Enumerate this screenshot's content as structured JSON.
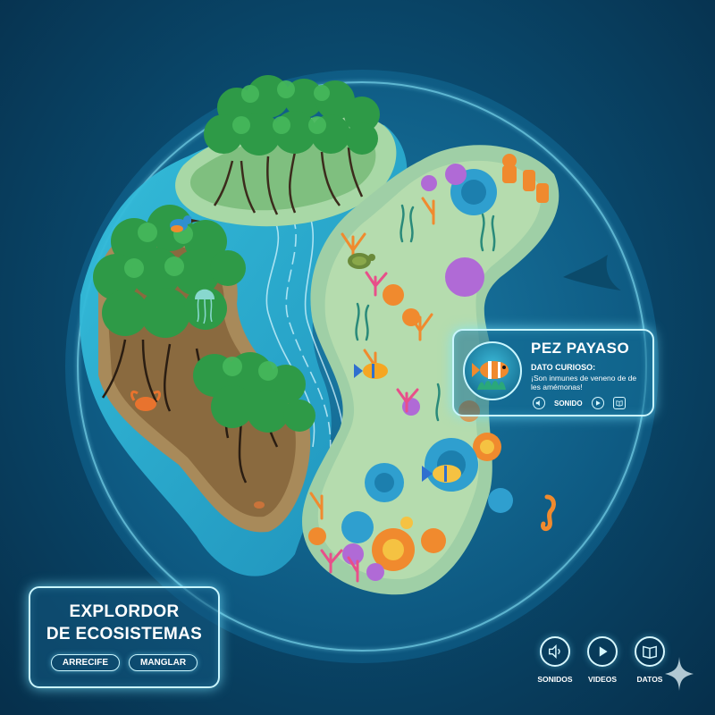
{
  "info_card": {
    "title": "PEZ PAYASO",
    "subtitle": "DATO CURIOSO:",
    "fact": "¡Son inmunes de veneno de de les amémonas!",
    "sound_label": "SONIDO",
    "thumbnail_icon": "clownfish-icon"
  },
  "explorer": {
    "title_line1": "EXPLORDOR",
    "title_line2": "DE ECOSISTEMAS",
    "buttons": [
      "ARRECIFE",
      "MANGLAR"
    ]
  },
  "nav": [
    {
      "label": "SONIDOS",
      "icon": "speaker-icon"
    },
    {
      "label": "VIDEOS",
      "icon": "play-icon"
    },
    {
      "label": "DATOS",
      "icon": "book-icon"
    }
  ],
  "colors": {
    "background": "#0a4a6e",
    "glow_border": "#c9f6ff",
    "water": "#2ab3d3",
    "sand": "#9fcfa6",
    "mangrove": "#2e9a47",
    "coral_orange": "#f08a2e",
    "coral_purple": "#b06ad6",
    "coral_blue": "#2f9fcf"
  }
}
